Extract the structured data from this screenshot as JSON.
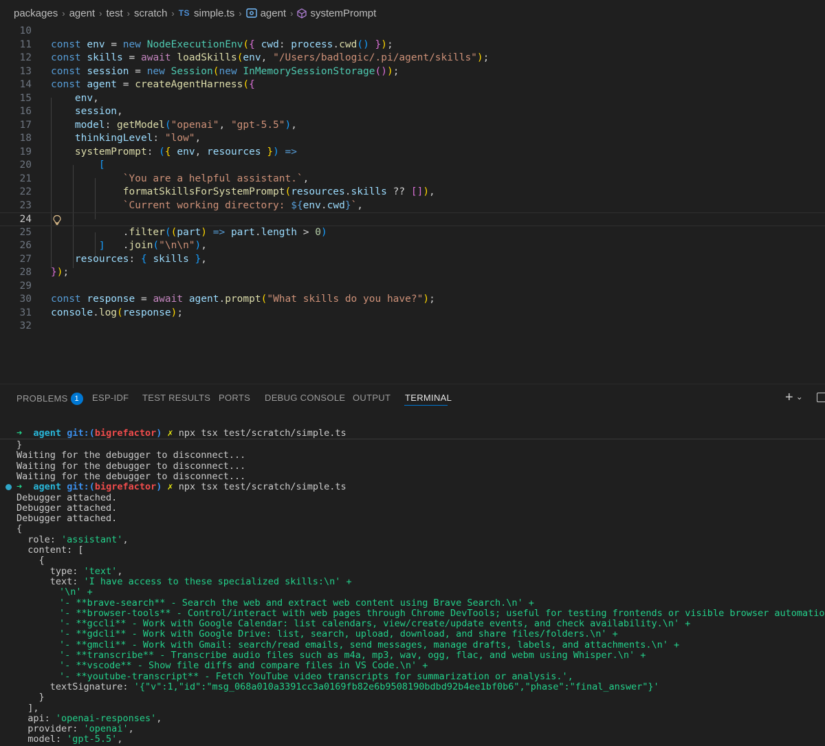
{
  "breadcrumb": {
    "items": [
      "packages",
      "agent",
      "test",
      "scratch"
    ],
    "file_badge": "TS",
    "file_name": "simple.ts",
    "symbol_var": "agent",
    "symbol_prop": "systemPrompt"
  },
  "editor": {
    "line_numbers": [
      "10",
      "11",
      "12",
      "13",
      "14",
      "15",
      "16",
      "17",
      "18",
      "19",
      "20",
      "21",
      "22",
      "23",
      "24",
      "25",
      "26",
      "27",
      "28",
      "29",
      "30",
      "31",
      "32"
    ],
    "current_line": "24",
    "strings": {
      "skills_path": "\"/Users/badlogic/.pi/agent/skills\"",
      "provider": "\"openai\"",
      "model": "\"gpt-5.5\"",
      "thinking": "\"low\"",
      "helpful": "`You are a helpful assistant.`",
      "cwd_prefix": "`Current working directory: ",
      "cwd_suffix": "`",
      "join_arg": "\"\\n\\n\"",
      "prompt": "\"What skills do you have?\""
    }
  },
  "panel": {
    "tabs": [
      "PROBLEMS",
      "ESP-IDF",
      "TEST RESULTS",
      "PORTS",
      "DEBUG CONSOLE",
      "OUTPUT",
      "TERMINAL"
    ],
    "problems_count": "1",
    "active_tab": "TERMINAL"
  },
  "terminal": {
    "prompt_arrow": "➜",
    "prompt_dir": "agent",
    "prompt_git": "git:(",
    "prompt_branch": "bigrefactor",
    "prompt_git_close": ")",
    "prompt_x": "✗",
    "command": "npx tsx test/scratch/simple.ts",
    "lines": [
      "}",
      "Waiting for the debugger to disconnect...",
      "Waiting for the debugger to disconnect...",
      "Waiting for the debugger to disconnect..."
    ],
    "attached": [
      "Debugger attached.",
      "Debugger attached.",
      "Debugger attached."
    ],
    "output": {
      "open": "{",
      "role_key": "  role: ",
      "role_val": "'assistant'",
      "role_end": ",",
      "content_key": "  content: [",
      "obj_open": "    {",
      "type_key": "      type: ",
      "type_val": "'text'",
      "type_end": ",",
      "text_key": "      text: ",
      "text_lines": [
        "'I have access to these specialized skills:\\n' +",
        "'\\n' +",
        "'- **brave-search** - Search the web and extract web content using Brave Search.\\n' +",
        "'- **browser-tools** - Control/interact with web pages through Chrome DevTools; useful for testing frontends or visible browser automation.\\n' +",
        "'- **gccli** - Work with Google Calendar: list calendars, view/create/update events, and check availability.\\n' +",
        "'- **gdcli** - Work with Google Drive: list, search, upload, download, and share files/folders.\\n' +",
        "'- **gmcli** - Work with Gmail: search/read emails, send messages, manage drafts, labels, and attachments.\\n' +",
        "'- **transcribe** - Transcribe audio files such as m4a, mp3, wav, ogg, flac, and webm using Whisper.\\n' +",
        "'- **vscode** - Show file diffs and compare files in VS Code.\\n' +",
        "'- **youtube-transcript** - Fetch YouTube video transcripts for summarization or analysis.',"
      ],
      "sig_key": "      textSignature: ",
      "sig_val": "'{\"v\":1,\"id\":\"msg_068a010a3391cc3a0169fb82e6b9508190bdbd92b4ee1bf0b6\",\"phase\":\"final_answer\"}'",
      "obj_close": "    }",
      "arr_close": "  ],",
      "api_key": "  api: ",
      "api_val": "'openai-responses'",
      "provider_key": "  provider: ",
      "provider_val": "'openai'",
      "model_key": "  model: ",
      "model_val": "'gpt-5.5'",
      "comma": ","
    }
  },
  "colors": {
    "background": "#1f1f1f",
    "accent": "#0078d4",
    "keyword": "#569cd6",
    "string": "#ce9178",
    "terminal_string": "#23d18b"
  }
}
